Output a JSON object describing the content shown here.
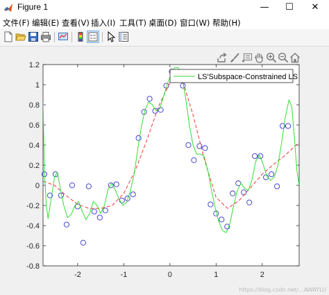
{
  "window": {
    "title": "Figure 1",
    "minimize_icon": "minimize-icon",
    "maximize_icon": "maximize-icon",
    "close_icon": "close-icon"
  },
  "menu": {
    "items": [
      {
        "label": "文件(F)"
      },
      {
        "label": "编辑(E)"
      },
      {
        "label": "查看(V)"
      },
      {
        "label": "插入(I)"
      },
      {
        "label": "工具(T)"
      },
      {
        "label": "桌面(D)"
      },
      {
        "label": "窗口(W)"
      },
      {
        "label": "帮助(H)"
      }
    ]
  },
  "toolbar": {
    "icons": [
      "new-figure-icon",
      "open-file-icon",
      "save-icon",
      "print-icon",
      "link-plot-icon",
      "colorbar-icon",
      "legend-icon",
      "pointer-icon",
      "property-editor-icon"
    ]
  },
  "axes_toolbar": {
    "icons": [
      "export-icon",
      "brush-icon",
      "data-tips-icon",
      "pan-icon",
      "zoom-in-icon",
      "zoom-out-icon",
      "home-icon"
    ]
  },
  "watermark": "https://blog.csdn.net/…AWAYLU",
  "colors": {
    "samples": "#3333cc",
    "ls_line": "#ee3333",
    "constrained_line": "#33dd33"
  },
  "chart_data": {
    "type": "line",
    "title": "",
    "xlabel": "",
    "ylabel": "",
    "xlim": [
      -2.75,
      2.8
    ],
    "ylim": [
      -0.8,
      1.2
    ],
    "xticks": [
      -2,
      -1,
      0,
      1,
      2
    ],
    "xtick_labels": [
      "-2",
      "-1",
      "0",
      "1",
      "2"
    ],
    "yticks": [
      -0.8,
      -0.6,
      -0.4,
      -0.2,
      0,
      0.2,
      0.4,
      0.6,
      0.8,
      1,
      1.2
    ],
    "ytick_labels": [
      "-0.8",
      "-0.6",
      "-0.4",
      "-0.2",
      "0",
      "0.2",
      "0.4",
      "0.6",
      "0.8",
      "1",
      "1.2"
    ],
    "grid": false,
    "legend": {
      "placement": "top-right",
      "entries": [
        {
          "label": "LS'Subspace-Constrained LS",
          "color": "#33dd33"
        }
      ]
    },
    "series": [
      {
        "kind": "scatter",
        "marker": "circle",
        "points": [
          [
            -2.72,
            0.11
          ],
          [
            -2.6,
            -0.1
          ],
          [
            -2.48,
            0.11
          ],
          [
            -2.36,
            -0.1
          ],
          [
            -2.24,
            -0.39
          ],
          [
            -2.12,
            0.0
          ],
          [
            -2.0,
            -0.21
          ],
          [
            -1.88,
            -0.57
          ],
          [
            -1.76,
            -0.01
          ],
          [
            -1.64,
            -0.26
          ],
          [
            -1.52,
            -0.32
          ],
          [
            -1.4,
            -0.25
          ],
          [
            -1.28,
            0.0
          ],
          [
            -1.16,
            0.01
          ],
          [
            -1.04,
            -0.15
          ],
          [
            -0.92,
            -0.13
          ],
          [
            -0.8,
            -0.09
          ],
          [
            -0.68,
            0.47
          ],
          [
            -0.56,
            0.73
          ],
          [
            -0.44,
            0.86
          ],
          [
            -0.32,
            0.74
          ],
          [
            -0.2,
            0.75
          ],
          [
            -0.08,
            0.99
          ],
          [
            0.04,
            1.13
          ],
          [
            0.16,
            1.12
          ],
          [
            0.28,
            0.99
          ],
          [
            0.4,
            0.4
          ],
          [
            0.52,
            0.25
          ],
          [
            0.64,
            0.39
          ],
          [
            0.76,
            0.37
          ],
          [
            0.88,
            -0.19
          ],
          [
            1.0,
            -0.28
          ],
          [
            1.12,
            -0.34
          ],
          [
            1.24,
            -0.41
          ],
          [
            1.36,
            -0.08
          ],
          [
            1.48,
            0.02
          ],
          [
            1.6,
            -0.07
          ],
          [
            1.72,
            -0.17
          ],
          [
            1.84,
            0.29
          ],
          [
            1.96,
            0.29
          ],
          [
            2.08,
            0.08
          ],
          [
            2.2,
            0.11
          ],
          [
            2.32,
            -0.01
          ],
          [
            2.44,
            0.59
          ],
          [
            2.56,
            0.59
          ]
        ]
      },
      {
        "kind": "line",
        "style": "dashed",
        "points": [
          [
            -2.75,
            0.04
          ],
          [
            -2.5,
            0.0
          ],
          [
            -2.25,
            -0.1
          ],
          [
            -2.0,
            -0.19
          ],
          [
            -1.75,
            -0.23
          ],
          [
            -1.5,
            -0.23
          ],
          [
            -1.25,
            -0.2
          ],
          [
            -1.0,
            -0.08
          ],
          [
            -0.75,
            0.15
          ],
          [
            -0.5,
            0.45
          ],
          [
            -0.25,
            0.78
          ],
          [
            0.0,
            1.02
          ],
          [
            0.15,
            1.09
          ],
          [
            0.3,
            1.0
          ],
          [
            0.5,
            0.7
          ],
          [
            0.75,
            0.25
          ],
          [
            1.0,
            -0.12
          ],
          [
            1.25,
            -0.23
          ],
          [
            1.5,
            -0.15
          ],
          [
            1.75,
            -0.02
          ],
          [
            2.0,
            0.11
          ],
          [
            2.25,
            0.21
          ],
          [
            2.5,
            0.3
          ],
          [
            2.8,
            0.43
          ]
        ]
      },
      {
        "kind": "line",
        "style": "solid",
        "points": [
          [
            -2.75,
            0.82
          ],
          [
            -2.72,
            0.15
          ],
          [
            -2.68,
            -0.2
          ],
          [
            -2.64,
            -0.33
          ],
          [
            -2.58,
            -0.15
          ],
          [
            -2.5,
            0.08
          ],
          [
            -2.44,
            0.13
          ],
          [
            -2.38,
            -0.02
          ],
          [
            -2.3,
            -0.2
          ],
          [
            -2.22,
            -0.32
          ],
          [
            -2.14,
            -0.29
          ],
          [
            -2.06,
            -0.2
          ],
          [
            -1.98,
            -0.16
          ],
          [
            -1.9,
            -0.26
          ],
          [
            -1.82,
            -0.34
          ],
          [
            -1.74,
            -0.28
          ],
          [
            -1.66,
            -0.16
          ],
          [
            -1.58,
            -0.2
          ],
          [
            -1.5,
            -0.28
          ],
          [
            -1.42,
            -0.2
          ],
          [
            -1.34,
            -0.04
          ],
          [
            -1.26,
            0.02
          ],
          [
            -1.18,
            -0.05
          ],
          [
            -1.1,
            -0.14
          ],
          [
            -1.02,
            -0.2
          ],
          [
            -0.94,
            -0.17
          ],
          [
            -0.86,
            -0.06
          ],
          [
            -0.78,
            0.1
          ],
          [
            -0.7,
            0.35
          ],
          [
            -0.62,
            0.58
          ],
          [
            -0.54,
            0.75
          ],
          [
            -0.46,
            0.83
          ],
          [
            -0.38,
            0.8
          ],
          [
            -0.3,
            0.74
          ],
          [
            -0.22,
            0.76
          ],
          [
            -0.14,
            0.88
          ],
          [
            -0.06,
            1.0
          ],
          [
            0.02,
            1.1
          ],
          [
            0.1,
            1.17
          ],
          [
            0.18,
            1.17
          ],
          [
            0.26,
            1.08
          ],
          [
            0.34,
            0.87
          ],
          [
            0.42,
            0.6
          ],
          [
            0.5,
            0.4
          ],
          [
            0.58,
            0.31
          ],
          [
            0.66,
            0.31
          ],
          [
            0.74,
            0.29
          ],
          [
            0.82,
            0.15
          ],
          [
            0.9,
            -0.05
          ],
          [
            0.98,
            -0.22
          ],
          [
            1.06,
            -0.36
          ],
          [
            1.14,
            -0.45
          ],
          [
            1.22,
            -0.47
          ],
          [
            1.3,
            -0.38
          ],
          [
            1.38,
            -0.2
          ],
          [
            1.46,
            -0.05
          ],
          [
            1.54,
            0.02
          ],
          [
            1.62,
            -0.03
          ],
          [
            1.7,
            -0.05
          ],
          [
            1.78,
            0.06
          ],
          [
            1.86,
            0.24
          ],
          [
            1.94,
            0.3
          ],
          [
            2.02,
            0.21
          ],
          [
            2.1,
            0.09
          ],
          [
            2.18,
            0.05
          ],
          [
            2.26,
            0.08
          ],
          [
            2.34,
            0.2
          ],
          [
            2.42,
            0.42
          ],
          [
            2.5,
            0.68
          ],
          [
            2.58,
            0.85
          ],
          [
            2.64,
            0.78
          ],
          [
            2.7,
            0.45
          ],
          [
            2.75,
            0.15
          ],
          [
            2.8,
            0.0
          ]
        ]
      }
    ]
  }
}
